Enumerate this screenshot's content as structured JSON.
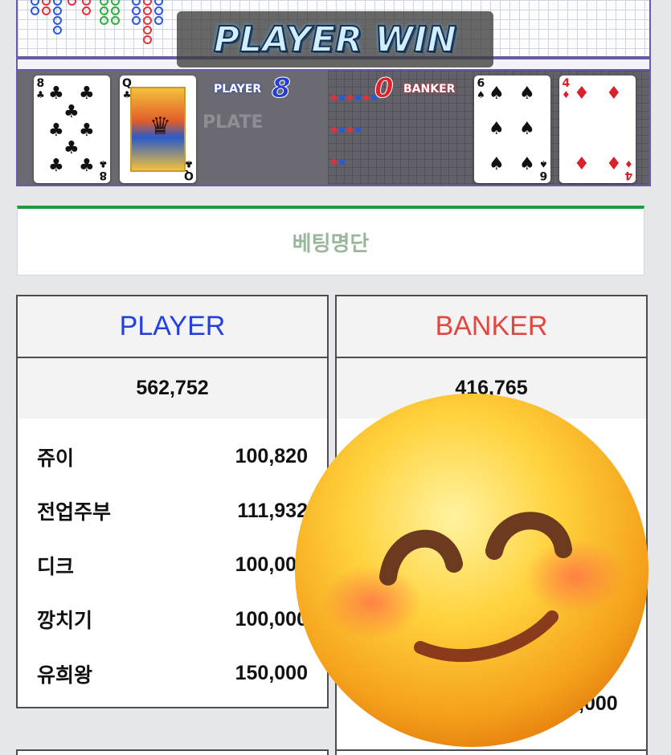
{
  "board": {
    "banner": "PLAYER WIN",
    "player_label": "PLAYER",
    "player_score": "8",
    "banker_label": "BANKER",
    "banker_score": "0",
    "faint_label": "PLATE",
    "player_cards": [
      {
        "rank": "8",
        "suit": "♣",
        "color": "black"
      },
      {
        "rank": "Q",
        "suit": "♣",
        "color": "black"
      }
    ],
    "banker_cards": [
      {
        "rank": "6",
        "suit": "♠",
        "color": "black"
      },
      {
        "rank": "4",
        "suit": "♦",
        "color": "red"
      }
    ]
  },
  "betting_list": {
    "title": "베팅명단"
  },
  "player_panel": {
    "title": "PLAYER",
    "total": "562,752",
    "rows": [
      {
        "name": "쥬이",
        "amount": "100,820"
      },
      {
        "name": "전업주부",
        "amount": "111,932"
      },
      {
        "name": "디크",
        "amount": "100,000"
      },
      {
        "name": "깡치기",
        "amount": "100,000"
      },
      {
        "name": "유희왕",
        "amount": "150,000"
      }
    ]
  },
  "banker_panel": {
    "title": "BANKER",
    "total": "416,765",
    "partial_amount": ",000"
  },
  "overlay": {
    "icon": "smiling-face-emoji"
  },
  "colors": {
    "player_blue": "#2340e0",
    "banker_red": "#e0483f",
    "list_accent_green": "#1f9a3d",
    "list_title_green": "#9ab79b",
    "board_border_purple": "#6a5aa8"
  }
}
